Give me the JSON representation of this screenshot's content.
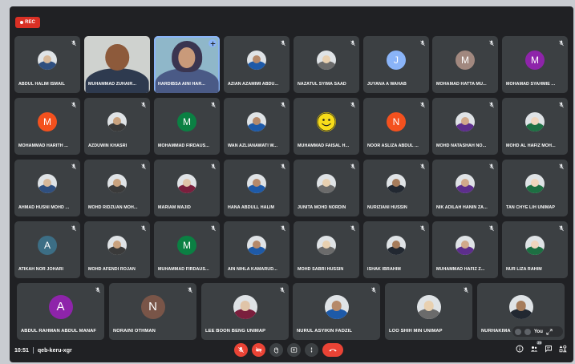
{
  "recording": {
    "label": "REC"
  },
  "meeting": {
    "time": "10:51",
    "code": "qeb-keru-xgr"
  },
  "participants": [
    {
      "name": "ABDUL HALIM ISMAIL"
    },
    {
      "name": "MUHAMMAD ZUHAIR..."
    },
    {
      "name": "HARDIBSA AINI HAR..."
    },
    {
      "name": "AZIAN AZAMIMI ABDU..."
    },
    {
      "name": "NAZATUL SYIMA SAAD"
    },
    {
      "name": "JUYANA A WAHAB",
      "initial": "J"
    },
    {
      "name": "MOHAMAD HATTA MU...",
      "initial": "M"
    },
    {
      "name": "MOHAMAD SYAHMIE ...",
      "initial": "M"
    },
    {
      "name": "MOHAMMAD HARITH ...",
      "initial": "M"
    },
    {
      "name": "AZDUWIN KHASRI"
    },
    {
      "name": "MOHAMMAD FIRDAUS...",
      "initial": "M"
    },
    {
      "name": "WAN AZLIANAWATI W..."
    },
    {
      "name": "MUHAMMAD FAISAL H..."
    },
    {
      "name": "NOOR ASLIZA ABDUL ...",
      "initial": "N"
    },
    {
      "name": "MOHD NATASHAH NO..."
    },
    {
      "name": "MOHD AL HAFIZ MOH..."
    },
    {
      "name": "AHMAD HUSNI MOHD ..."
    },
    {
      "name": "MOHD RIDZUAN MOH..."
    },
    {
      "name": "MARIAM MAJID"
    },
    {
      "name": "HANA ABDULL HALIM"
    },
    {
      "name": "JUNITA MOHD NORDIN"
    },
    {
      "name": "NURIZIANI HUSSIN"
    },
    {
      "name": "NIK ADILAH HANIN ZA..."
    },
    {
      "name": "TAN CHYE LIH UNIMAP"
    },
    {
      "name": "ATIKAH NOR JOHARI",
      "initial": "A"
    },
    {
      "name": "MOHD AFENDI ROJAN"
    },
    {
      "name": "MUHAMMAD FIRDAUS...",
      "initial": "M"
    },
    {
      "name": "AIN NIHLA KAMARUD..."
    },
    {
      "name": "MOHD SABRI HUSSIN"
    },
    {
      "name": "ISHAK IBRAHIM"
    },
    {
      "name": "MUHAMMAD HAFIZ Z..."
    },
    {
      "name": "NUR LIZA RAHIM"
    },
    {
      "name": "ABDUL RAHMAN ABDUL MANAF",
      "initial": "A"
    },
    {
      "name": "NORAINI OTHMAN",
      "initial": "N"
    },
    {
      "name": "LEE BOON BENG UNIMAP"
    },
    {
      "name": "NURUL ASYIKIN FADZIL"
    },
    {
      "name": "LOO SHIH MIN UNIMAP"
    },
    {
      "name": "NURHAKIMA"
    }
  ],
  "self_tile": {
    "label": "You"
  },
  "people_count": "39",
  "colors": {
    "background": "#202124",
    "tile": "#3c4043",
    "hangup": "#ea4335",
    "active_border": "#8ab4f8"
  }
}
